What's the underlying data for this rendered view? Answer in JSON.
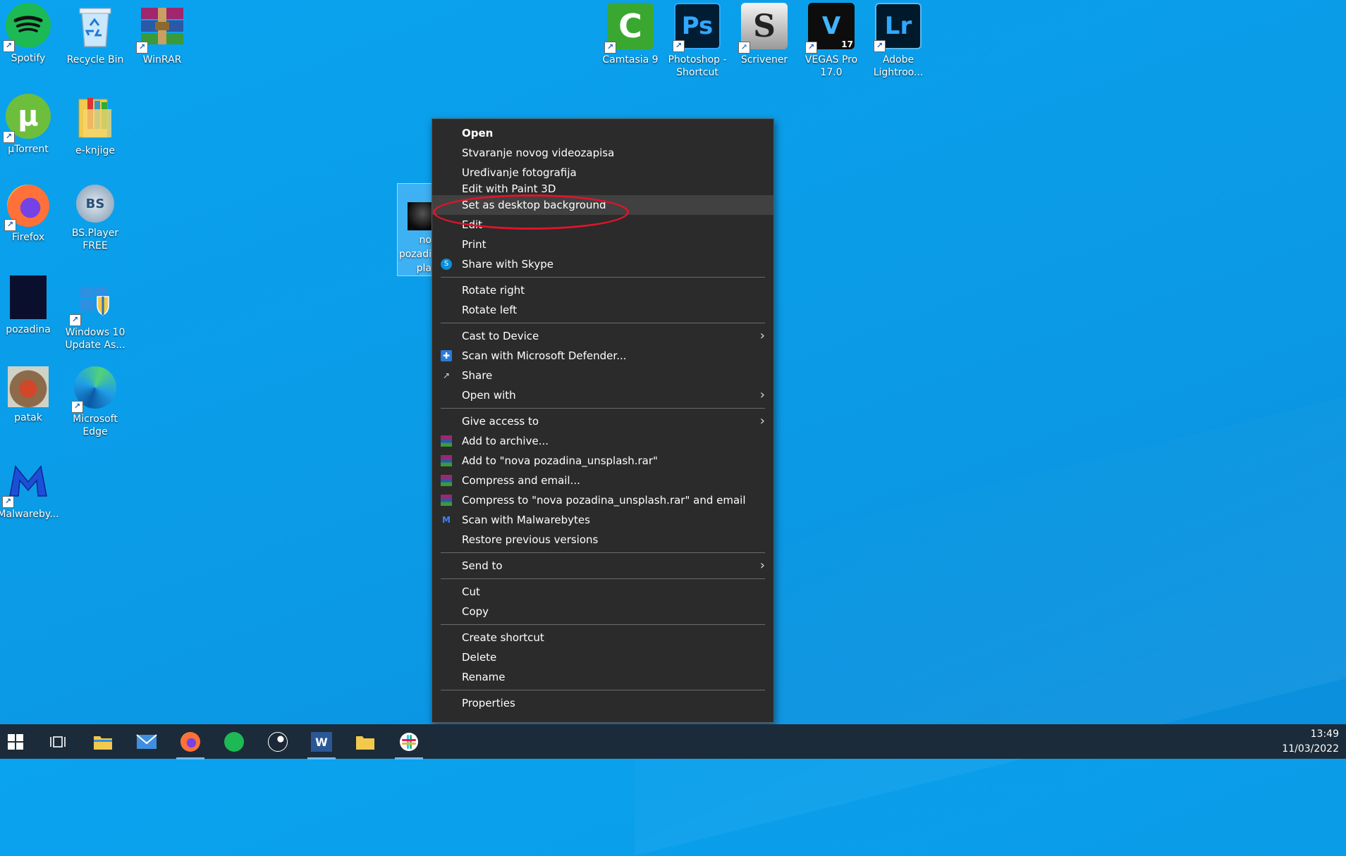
{
  "desktop_icons": {
    "spotify": "Spotify",
    "recycle_bin": "Recycle Bin",
    "winrar": "WinRAR",
    "utorrent": "µTorrent",
    "eknjige": "e-knjige",
    "firefox": "Firefox",
    "bsplayer": "BS.Player FREE",
    "pozadina": "pozadina",
    "win10update": "Windows 10 Update As...",
    "patak": "patak",
    "edge": "Microsoft Edge",
    "malwarebytes": "Malwareby...",
    "camtasia": "Camtasia 9",
    "photoshop": "Photoshop - Shortcut",
    "scrivener": "Scrivener",
    "vegas": "VEGAS Pro 17.0",
    "lightroom": "Adobe Lightroo...",
    "selected_file_line1": "no",
    "selected_file_line2": "pozadi",
    "selected_file_line3": "pla"
  },
  "icon_glyphs": {
    "photoshop": "Ps",
    "vegas": "V",
    "vegas_badge": "17",
    "lightroom": "Lr",
    "scrivener": "S",
    "bsplayer": "BS"
  },
  "menu": {
    "open": "Open",
    "stvaranje": "Stvaranje novog videozapisa",
    "uredivanje": "Uređivanje fotografija",
    "edit_paint3d": "Edit with Paint 3D",
    "set_bg": "Set as desktop background",
    "edit": "Edit",
    "print": "Print",
    "share_skype": "Share with Skype",
    "rotate_right": "Rotate right",
    "rotate_left": "Rotate left",
    "cast": "Cast to Device",
    "defender": "Scan with Microsoft Defender...",
    "share": "Share",
    "open_with": "Open with",
    "give_access": "Give access to",
    "add_archive": "Add to archive...",
    "add_rar": "Add to \"nova pozadina_unsplash.rar\"",
    "compress_email": "Compress and email...",
    "compress_rar_email": "Compress to \"nova pozadina_unsplash.rar\" and email",
    "malwarebytes": "Scan with Malwarebytes",
    "restore": "Restore previous versions",
    "send_to": "Send to",
    "cut": "Cut",
    "copy": "Copy",
    "create_shortcut": "Create shortcut",
    "delete": "Delete",
    "rename": "Rename",
    "properties": "Properties"
  },
  "taskbar": {
    "time": "13:49",
    "date": "11/03/2022"
  },
  "colors": {
    "desktop": "#0aa3ef",
    "menu_bg": "#2b2b2b",
    "highlight": "#414141",
    "annotation": "#e0142b",
    "taskbar": "#1c2b39"
  }
}
